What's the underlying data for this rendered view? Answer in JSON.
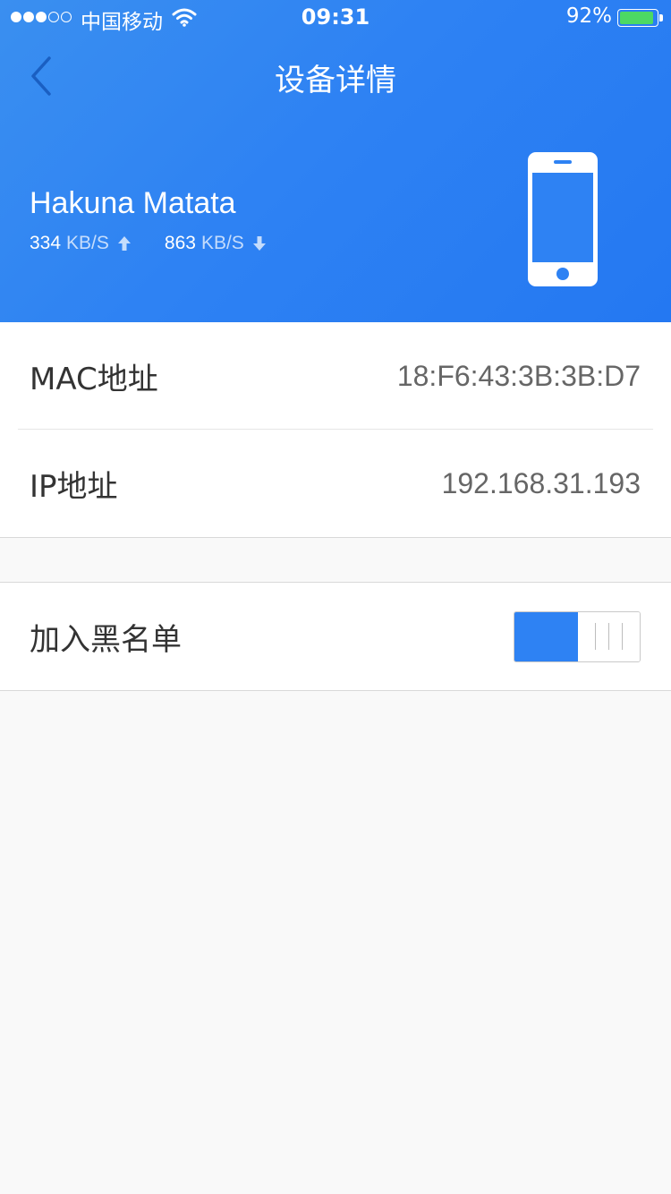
{
  "status_bar": {
    "carrier": "中国移动",
    "time": "09:31",
    "battery": "92%",
    "battery_level": 0.92,
    "signal_bars_filled": 3,
    "signal_bars_total": 5
  },
  "nav": {
    "title": "设备详情",
    "back_icon": "chevron-left-icon"
  },
  "device": {
    "name": "Hakuna Matata",
    "upload_value": "334",
    "upload_unit": "KB/S",
    "download_value": "863",
    "download_unit": "KB/S",
    "icon": "smartphone-icon"
  },
  "details": {
    "mac_label": "MAC地址",
    "mac_value": "18:F6:43:3B:3B:D7",
    "ip_label": "IP地址",
    "ip_value": "192.168.31.193"
  },
  "blacklist": {
    "label": "加入黑名单",
    "enabled": true
  },
  "colors": {
    "primary": "#2e82f3",
    "battery": "#4cd964"
  }
}
